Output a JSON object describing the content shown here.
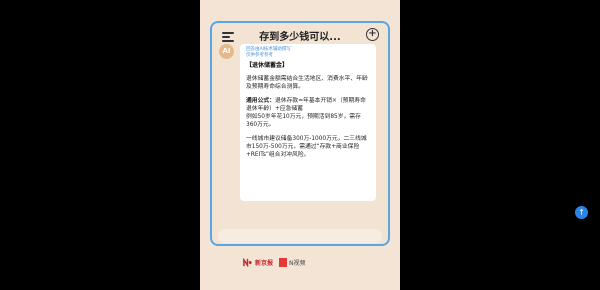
{
  "header": {
    "title": "存到多少钱可以...",
    "menu_icon": "menu-icon",
    "new_chat_icon": "new-chat-icon"
  },
  "message": {
    "avatar_label": "AI",
    "meta_line1": "回答由AI技术辅助撰写",
    "meta_line2": "仅供参考参考",
    "heading": "【退休储蓄金】",
    "para1": "退休储蓄金额需结合生活地区、消费水平、年龄及预期寿命综合测算。",
    "para2_label": "通用公式：",
    "para2_text": "退休存款=年基本开销×（预期寿命 退休年龄）+应急储蓄",
    "para2_example": "例如50岁年花10万元，预期活到85岁，需存360万元。",
    "para3": "一线城市建议储备300万-1000万元，二三线城市150万-500万元，需通过“存款+商业保险+REITs”组合对冲风险。"
  },
  "input": {
    "placeholder": "",
    "send_icon": "send-icon"
  },
  "footer": {
    "logo1_text": "新京报",
    "logo2_text": "N视频"
  },
  "colors": {
    "accent": "#5aa5e3",
    "send": "#2b83e6",
    "background": "#f4e4d6"
  }
}
